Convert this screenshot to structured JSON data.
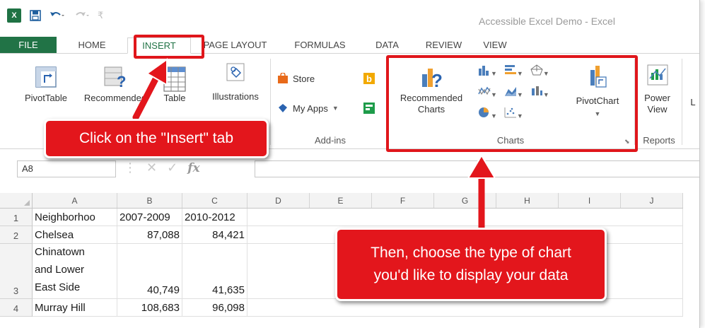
{
  "app": {
    "window_title": "Accessible Excel Demo - Excel",
    "logo_text": "X",
    "brand_color": "#217346"
  },
  "tabs": [
    {
      "label": "FILE"
    },
    {
      "label": "HOME"
    },
    {
      "label": "INSERT"
    },
    {
      "label": "PAGE LAYOUT"
    },
    {
      "label": "FORMULAS"
    },
    {
      "label": "DATA"
    },
    {
      "label": "REVIEW"
    },
    {
      "label": "VIEW"
    }
  ],
  "ribbon": {
    "pivottable": "PivotTable",
    "recommended_tables": "Recommended",
    "table": "Table",
    "illustrations": "Illustrations",
    "store": "Store",
    "my_apps": "My Apps",
    "addins_group": "Add-ins",
    "recommended_charts_line1": "Recommended",
    "recommended_charts_line2": "Charts",
    "pivotchart": "PivotChart",
    "charts_group": "Charts",
    "power_view_line1": "Power",
    "power_view_line2": "View",
    "reports_group": "Reports",
    "partial_next": "L"
  },
  "formula_bar": {
    "name_box": "A8",
    "fx": "fx"
  },
  "sheet": {
    "columns": [
      "A",
      "B",
      "C",
      "D",
      "E",
      "F",
      "G",
      "H",
      "I",
      "J"
    ],
    "rows": [
      {
        "num": "1",
        "a": "Neighborhoo",
        "b": "2007-2009",
        "c": "2010-2012"
      },
      {
        "num": "2",
        "a": "Chelsea",
        "b": "87,088",
        "c": "84,421"
      },
      {
        "num": "3",
        "a1": "Chinatown",
        "a2": "and Lower",
        "a3": "East Side",
        "b": "40,749",
        "c": "41,635"
      },
      {
        "num": "4",
        "a": "Murray Hill",
        "b": "108,683",
        "c": "96,098"
      }
    ]
  },
  "annotations": {
    "callout_insert": "Click on the \"Insert\" tab",
    "callout_charts_line1": "Then, choose the type of chart",
    "callout_charts_line2": "you'd like to display your data",
    "highlight_color": "#e0161b"
  }
}
